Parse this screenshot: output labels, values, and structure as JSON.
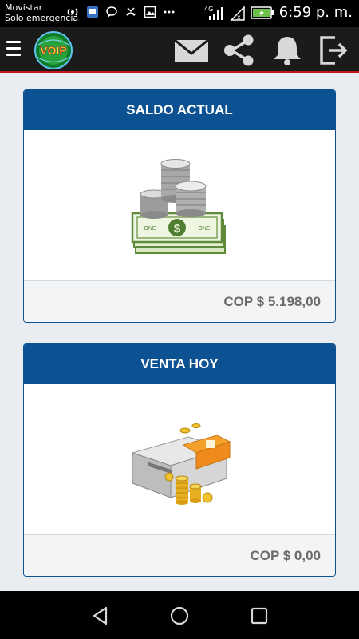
{
  "status": {
    "carrier_line1": "Movistar",
    "carrier_line2": "Solo emergencia",
    "network_type": "4G",
    "time": "6:59 p. m."
  },
  "app_bar": {
    "logo_text": "VOIP",
    "icons": [
      "menu-icon",
      "mail-icon",
      "share-icon",
      "bell-icon",
      "logout-icon"
    ]
  },
  "cards": {
    "balance": {
      "title": "SALDO ACTUAL",
      "amount": "COP $ 5.198,00",
      "icon": "money-stack-icon",
      "banknote_label": "ONE"
    },
    "sales": {
      "title": "VENTA HOY",
      "amount": "COP $ 0,00",
      "icon": "cash-register-icon"
    }
  },
  "colors": {
    "header_blue": "#0c5191",
    "app_bar_bg": "#1b1b1b",
    "accent_red": "#c0181c",
    "page_bg": "#e9edf2",
    "amount_gray": "#6b6b6b"
  }
}
